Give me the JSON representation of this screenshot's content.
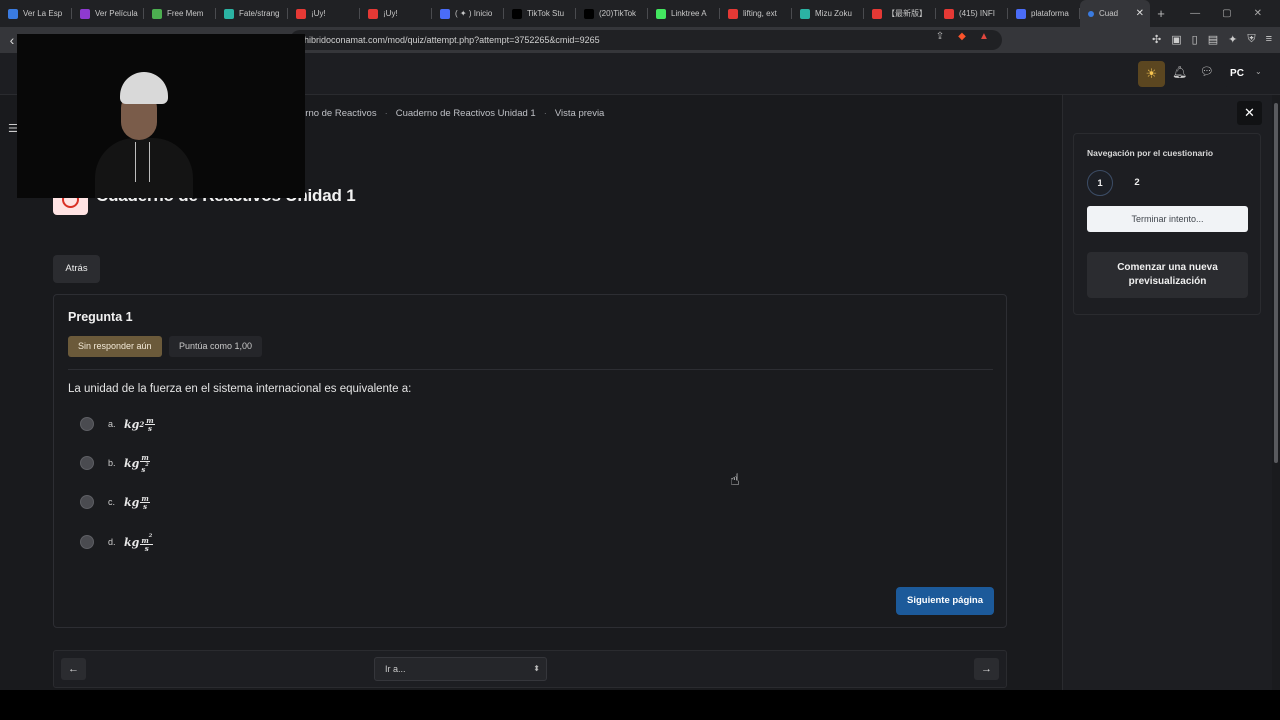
{
  "browser": {
    "tabs": [
      {
        "label": "Ver La Esp",
        "color": "#3a7be0"
      },
      {
        "label": "Ver Película",
        "color": "#8e3ad0"
      },
      {
        "label": "Free Mem",
        "color": "#4caf50"
      },
      {
        "label": "Fate/strang",
        "color": "#2bb3a3"
      },
      {
        "label": "¡Uy!",
        "color": "#e53935"
      },
      {
        "label": "¡Uy!",
        "color": "#e53935"
      },
      {
        "label": "( ✦ ) Inicio",
        "color": "#4a6cf7"
      },
      {
        "label": "TikTok Stu",
        "color": "#000000"
      },
      {
        "label": "(20)TikTok",
        "color": "#000000"
      },
      {
        "label": "Linktree A",
        "color": "#43e660"
      },
      {
        "label": "lifting, ext",
        "color": "#e53935"
      },
      {
        "label": "Mizu Zoku",
        "color": "#2bb3a3"
      },
      {
        "label": "【最新版】",
        "color": "#e53935"
      },
      {
        "label": "(415) INFI",
        "color": "#e53935"
      },
      {
        "label": "plataforma",
        "color": "#4a6cf7"
      }
    ],
    "active_tab": {
      "label": "Cuad",
      "close": "✕"
    },
    "new_tab": "+",
    "url": "hibridoconamat.com/mod/quiz/attempt.php?attempt=3752265&cmid=9265",
    "window_controls": [
      "—",
      "▢",
      "✕"
    ]
  },
  "header": {
    "theme_icon": "sun-icon",
    "notification_icon": "bell-icon",
    "messages_icon": "chat-icon",
    "avatar_initials": "PC",
    "avatar_caret": "⌄",
    "menu_icon": "☰"
  },
  "breadcrumb": {
    "items": [
      "erno de Reactivos",
      "Cuaderno de Reactivos Unidad 1",
      "Vista previa"
    ],
    "separator": "·"
  },
  "page": {
    "title": "Cuaderno de Reactivos Unidad 1",
    "back_label": "Atrás"
  },
  "question": {
    "title": "Pregunta 1",
    "state": "Sin responder aún",
    "grade": "Puntúa como 1,00",
    "text": "La unidad de la fuerza en el sistema internacional es equivalente a:",
    "options": [
      {
        "letter": "a.",
        "base": "kg",
        "exp": "2",
        "num": "m",
        "den": "s",
        "den_exp": ""
      },
      {
        "letter": "b.",
        "base": "kg",
        "exp": "",
        "num": "m",
        "den": "s",
        "den_exp": "2"
      },
      {
        "letter": "c.",
        "base": "kg",
        "exp": "",
        "num": "m",
        "den": "s",
        "den_exp": ""
      },
      {
        "letter": "d.",
        "base": "kg",
        "exp": "",
        "num": "m",
        "num_exp": "2",
        "den": "s",
        "den_exp": ""
      }
    ],
    "next_label": "Siguiente página"
  },
  "navigation": {
    "prev_icon": "←",
    "next_icon": "→",
    "jump_placeholder": "Ir a...",
    "jump_arrow": "⬍"
  },
  "drawer": {
    "close_icon": "✕",
    "panel_title": "Navegación por el cuestionario",
    "question_numbers": [
      "1",
      "2"
    ],
    "finish_label": "Terminar intento...",
    "new_preview_label": "Comenzar una nueva previsualización"
  },
  "colors": {
    "accent_blue": "#1c5a9a",
    "state_badge": "#6b5a3a",
    "theme_button": "#5b4620"
  }
}
